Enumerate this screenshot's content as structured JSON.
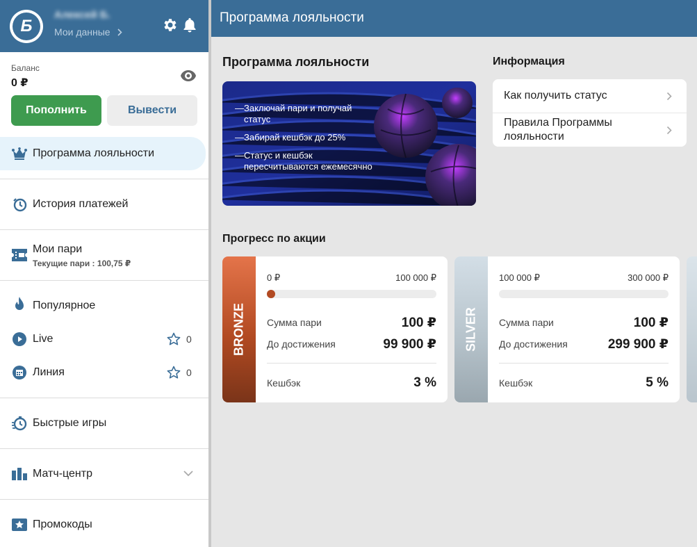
{
  "profile": {
    "user_name": "Алексей Б.",
    "my_data": "Мои данные"
  },
  "balance": {
    "label": "Баланс",
    "value": "0 ₽"
  },
  "buttons": {
    "deposit": "Пополнить",
    "withdraw": "Вывести"
  },
  "nav": {
    "loyalty": "Программа лояльности",
    "payments": "История платежей",
    "my_bets": "Мои пари",
    "current_bets": "Текущие пари : 100,75 ₽",
    "popular": "Популярное",
    "live": "Live",
    "live_count": "0",
    "line": "Линия",
    "line_count": "0",
    "fast_games": "Быстрые игры",
    "match_center": "Матч-центр",
    "promo": "Промокоды"
  },
  "header": {
    "title": "Программа лояльности"
  },
  "main": {
    "title": "Программа лояльности",
    "banner_items": [
      "Заключай пари и получай статус",
      "Забирай кешбэк до 25%",
      "Статус и кешбэк пересчитываются ежемесячно"
    ],
    "info_title": "Информация",
    "info_items": [
      "Как получить статус",
      "Правила Программы лояльности"
    ],
    "progress_title": "Прогресс по акции"
  },
  "levels": [
    {
      "name": "BRONZE",
      "range_from": "0 ₽",
      "range_to": "100 000 ₽",
      "progress": 0.0,
      "bet_sum_label": "Сумма пари",
      "bet_sum": "100 ₽",
      "to_reach_label": "До достижения",
      "to_reach": "99 900 ₽",
      "cashback_label": "Кешбэк",
      "cashback": "3 %"
    },
    {
      "name": "SILVER",
      "range_from": "100 000 ₽",
      "range_to": "300 000 ₽",
      "progress": 0.0,
      "bet_sum_label": "Сумма пари",
      "bet_sum": "100 ₽",
      "to_reach_label": "До достижения",
      "to_reach": "299 900 ₽",
      "cashback_label": "Кешбэк",
      "cashback": "5 %"
    }
  ],
  "colors": {
    "brand": "#3a6d97",
    "deposit": "#3e9b4f",
    "bronze": "#b24a22",
    "silver": "#b7c4cc"
  }
}
